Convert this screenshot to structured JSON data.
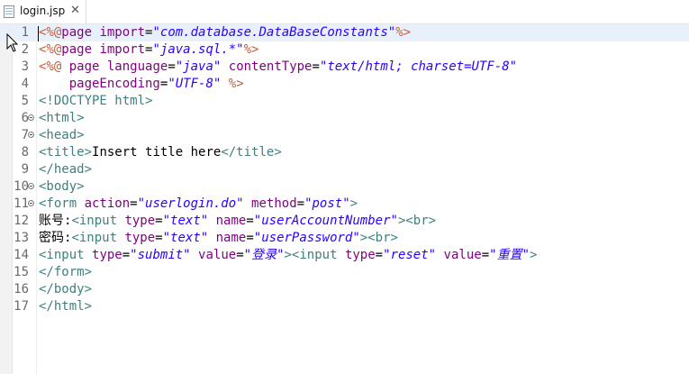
{
  "tab": {
    "label": "login.jsp",
    "close": "✕"
  },
  "colors": {
    "tag": "#3f7f7f",
    "attr": "#7f007f",
    "str": "#2a00ff",
    "text": "#000000",
    "jsp": "#bf5f3f",
    "current_line_bg": "#e8f1fb"
  },
  "editor": {
    "current_line": 1,
    "lines": [
      {
        "n": "1",
        "fold": false,
        "tokens": [
          [
            "jsp",
            "<%@"
          ],
          [
            "attr",
            "page "
          ],
          [
            "attr",
            "import"
          ],
          [
            "text",
            "="
          ],
          [
            "str",
            "\"com.database.DataBaseConstants\""
          ],
          [
            "jsp",
            "%>"
          ]
        ]
      },
      {
        "n": "2",
        "fold": false,
        "tokens": [
          [
            "jsp",
            "<%@"
          ],
          [
            "attr",
            "page "
          ],
          [
            "attr",
            "import"
          ],
          [
            "text",
            "="
          ],
          [
            "str",
            "\"java.sql.*\""
          ],
          [
            "jsp",
            "%>"
          ]
        ]
      },
      {
        "n": "3",
        "fold": false,
        "tokens": [
          [
            "jsp",
            "<%@ "
          ],
          [
            "attr",
            "page "
          ],
          [
            "attr",
            "language"
          ],
          [
            "text",
            "="
          ],
          [
            "str",
            "\"java\""
          ],
          [
            "text",
            " "
          ],
          [
            "attr",
            "contentType"
          ],
          [
            "text",
            "="
          ],
          [
            "str",
            "\"text/html; charset=UTF-8\""
          ]
        ]
      },
      {
        "n": "4",
        "fold": false,
        "tokens": [
          [
            "text",
            "    "
          ],
          [
            "attr",
            "pageEncoding"
          ],
          [
            "text",
            "="
          ],
          [
            "str",
            "\"UTF-8\""
          ],
          [
            "text",
            " "
          ],
          [
            "jsp",
            "%>"
          ]
        ]
      },
      {
        "n": "5",
        "fold": false,
        "tokens": [
          [
            "tag",
            "<!DOCTYPE html>"
          ]
        ]
      },
      {
        "n": "6",
        "fold": true,
        "tokens": [
          [
            "tag",
            "<html>"
          ]
        ]
      },
      {
        "n": "7",
        "fold": true,
        "tokens": [
          [
            "tag",
            "<head>"
          ]
        ]
      },
      {
        "n": "8",
        "fold": false,
        "tokens": [
          [
            "tag",
            "<title>"
          ],
          [
            "text",
            "Insert title here"
          ],
          [
            "tag",
            "</title>"
          ]
        ]
      },
      {
        "n": "9",
        "fold": false,
        "tokens": [
          [
            "tag",
            "</head>"
          ]
        ]
      },
      {
        "n": "10",
        "fold": true,
        "tokens": [
          [
            "tag",
            "<body>"
          ]
        ]
      },
      {
        "n": "11",
        "fold": true,
        "tokens": [
          [
            "tag",
            "<form "
          ],
          [
            "attr",
            "action"
          ],
          [
            "text",
            "="
          ],
          [
            "str",
            "\"userlogin.do\""
          ],
          [
            "text",
            " "
          ],
          [
            "attr",
            "method"
          ],
          [
            "text",
            "="
          ],
          [
            "str",
            "\"post\""
          ],
          [
            "tag",
            ">"
          ]
        ]
      },
      {
        "n": "12",
        "fold": false,
        "tokens": [
          [
            "text",
            "账号:"
          ],
          [
            "tag",
            "<input "
          ],
          [
            "attr",
            "type"
          ],
          [
            "text",
            "="
          ],
          [
            "str",
            "\"text\""
          ],
          [
            "text",
            " "
          ],
          [
            "attr",
            "name"
          ],
          [
            "text",
            "="
          ],
          [
            "str",
            "\"userAccountNumber\""
          ],
          [
            "tag",
            "><br>"
          ]
        ]
      },
      {
        "n": "13",
        "fold": false,
        "tokens": [
          [
            "text",
            "密码:"
          ],
          [
            "tag",
            "<input "
          ],
          [
            "attr",
            "type"
          ],
          [
            "text",
            "="
          ],
          [
            "str",
            "\"text\""
          ],
          [
            "text",
            " "
          ],
          [
            "attr",
            "name"
          ],
          [
            "text",
            "="
          ],
          [
            "str",
            "\"userPassword\""
          ],
          [
            "tag",
            "><br>"
          ]
        ]
      },
      {
        "n": "14",
        "fold": false,
        "tokens": [
          [
            "tag",
            "<input "
          ],
          [
            "attr",
            "type"
          ],
          [
            "text",
            "="
          ],
          [
            "str",
            "\"submit\""
          ],
          [
            "text",
            " "
          ],
          [
            "attr",
            "value"
          ],
          [
            "text",
            "="
          ],
          [
            "str",
            "\"登录\""
          ],
          [
            "tag",
            "><input "
          ],
          [
            "attr",
            "type"
          ],
          [
            "text",
            "="
          ],
          [
            "str",
            "\"reset\""
          ],
          [
            "text",
            " "
          ],
          [
            "attr",
            "value"
          ],
          [
            "text",
            "="
          ],
          [
            "str",
            "\"重置\""
          ],
          [
            "tag",
            ">"
          ]
        ]
      },
      {
        "n": "15",
        "fold": false,
        "tokens": [
          [
            "tag",
            "</form>"
          ]
        ]
      },
      {
        "n": "16",
        "fold": false,
        "tokens": [
          [
            "tag",
            "</body>"
          ]
        ]
      },
      {
        "n": "17",
        "fold": false,
        "tokens": [
          [
            "tag",
            "</html>"
          ]
        ]
      }
    ]
  }
}
